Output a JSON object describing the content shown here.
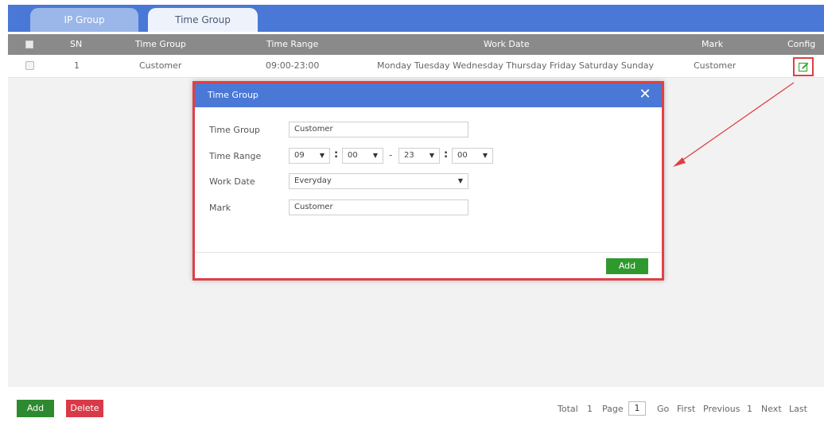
{
  "tabs": [
    {
      "label": "IP Group",
      "active": false
    },
    {
      "label": "Time Group",
      "active": true
    }
  ],
  "table": {
    "columns": [
      "SN",
      "Time Group",
      "Time Range",
      "Work Date",
      "Mark",
      "Config"
    ],
    "rows": [
      {
        "sn": "1",
        "time_group": "Customer",
        "time_range": "09:00-23:00",
        "work_date": "Monday Tuesday Wednesday Thursday Friday Saturday Sunday",
        "mark": "Customer",
        "config_icon": "edit-icon"
      }
    ]
  },
  "dialog": {
    "title": "Time Group",
    "close_icon": "close-icon",
    "fields": {
      "time_group_label": "Time Group",
      "time_group_value": "Customer",
      "time_range_label": "Time Range",
      "start_hour": "09",
      "start_minute": "00",
      "end_hour": "23",
      "end_minute": "00",
      "colon": ":",
      "dash": "-",
      "work_date_label": "Work Date",
      "work_date_value": "Everyday",
      "mark_label": "Mark",
      "mark_value": "Customer"
    },
    "add_label": "Add",
    "dropdown_icon": "triangle-down-icon"
  },
  "footer": {
    "add_label": "Add",
    "delete_label": "Delete",
    "pager": {
      "total_label": "Total",
      "total_value": "1",
      "page_label": "Page",
      "page_value": "1",
      "go_label": "Go",
      "first_label": "First",
      "previous_label": "Previous",
      "current_page": "1",
      "next_label": "Next",
      "last_label": "Last"
    }
  },
  "colors": {
    "tabbar": "#4a78d6",
    "header_row": "#8a8a8a",
    "dialog_border": "#e04048",
    "add_button": "#2e8a2e",
    "delete_button": "#d83a48",
    "annotation": "#e04040"
  }
}
